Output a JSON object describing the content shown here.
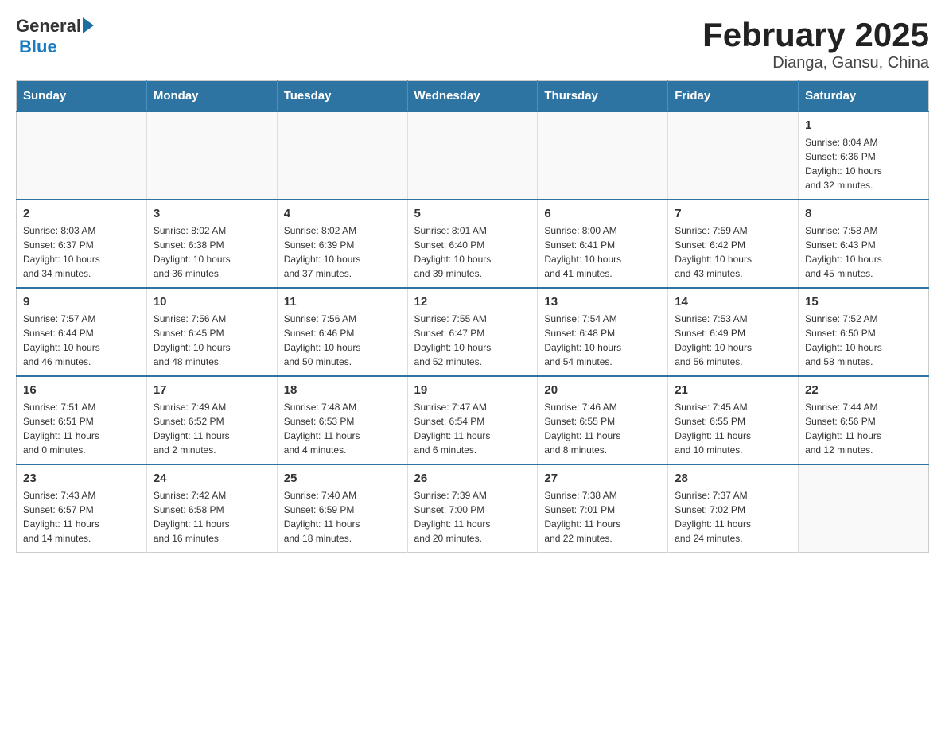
{
  "logo": {
    "general": "General",
    "blue": "Blue"
  },
  "title": "February 2025",
  "subtitle": "Dianga, Gansu, China",
  "weekdays": [
    "Sunday",
    "Monday",
    "Tuesday",
    "Wednesday",
    "Thursday",
    "Friday",
    "Saturday"
  ],
  "weeks": [
    [
      {
        "day": "",
        "info": ""
      },
      {
        "day": "",
        "info": ""
      },
      {
        "day": "",
        "info": ""
      },
      {
        "day": "",
        "info": ""
      },
      {
        "day": "",
        "info": ""
      },
      {
        "day": "",
        "info": ""
      },
      {
        "day": "1",
        "info": "Sunrise: 8:04 AM\nSunset: 6:36 PM\nDaylight: 10 hours\nand 32 minutes."
      }
    ],
    [
      {
        "day": "2",
        "info": "Sunrise: 8:03 AM\nSunset: 6:37 PM\nDaylight: 10 hours\nand 34 minutes."
      },
      {
        "day": "3",
        "info": "Sunrise: 8:02 AM\nSunset: 6:38 PM\nDaylight: 10 hours\nand 36 minutes."
      },
      {
        "day": "4",
        "info": "Sunrise: 8:02 AM\nSunset: 6:39 PM\nDaylight: 10 hours\nand 37 minutes."
      },
      {
        "day": "5",
        "info": "Sunrise: 8:01 AM\nSunset: 6:40 PM\nDaylight: 10 hours\nand 39 minutes."
      },
      {
        "day": "6",
        "info": "Sunrise: 8:00 AM\nSunset: 6:41 PM\nDaylight: 10 hours\nand 41 minutes."
      },
      {
        "day": "7",
        "info": "Sunrise: 7:59 AM\nSunset: 6:42 PM\nDaylight: 10 hours\nand 43 minutes."
      },
      {
        "day": "8",
        "info": "Sunrise: 7:58 AM\nSunset: 6:43 PM\nDaylight: 10 hours\nand 45 minutes."
      }
    ],
    [
      {
        "day": "9",
        "info": "Sunrise: 7:57 AM\nSunset: 6:44 PM\nDaylight: 10 hours\nand 46 minutes."
      },
      {
        "day": "10",
        "info": "Sunrise: 7:56 AM\nSunset: 6:45 PM\nDaylight: 10 hours\nand 48 minutes."
      },
      {
        "day": "11",
        "info": "Sunrise: 7:56 AM\nSunset: 6:46 PM\nDaylight: 10 hours\nand 50 minutes."
      },
      {
        "day": "12",
        "info": "Sunrise: 7:55 AM\nSunset: 6:47 PM\nDaylight: 10 hours\nand 52 minutes."
      },
      {
        "day": "13",
        "info": "Sunrise: 7:54 AM\nSunset: 6:48 PM\nDaylight: 10 hours\nand 54 minutes."
      },
      {
        "day": "14",
        "info": "Sunrise: 7:53 AM\nSunset: 6:49 PM\nDaylight: 10 hours\nand 56 minutes."
      },
      {
        "day": "15",
        "info": "Sunrise: 7:52 AM\nSunset: 6:50 PM\nDaylight: 10 hours\nand 58 minutes."
      }
    ],
    [
      {
        "day": "16",
        "info": "Sunrise: 7:51 AM\nSunset: 6:51 PM\nDaylight: 11 hours\nand 0 minutes."
      },
      {
        "day": "17",
        "info": "Sunrise: 7:49 AM\nSunset: 6:52 PM\nDaylight: 11 hours\nand 2 minutes."
      },
      {
        "day": "18",
        "info": "Sunrise: 7:48 AM\nSunset: 6:53 PM\nDaylight: 11 hours\nand 4 minutes."
      },
      {
        "day": "19",
        "info": "Sunrise: 7:47 AM\nSunset: 6:54 PM\nDaylight: 11 hours\nand 6 minutes."
      },
      {
        "day": "20",
        "info": "Sunrise: 7:46 AM\nSunset: 6:55 PM\nDaylight: 11 hours\nand 8 minutes."
      },
      {
        "day": "21",
        "info": "Sunrise: 7:45 AM\nSunset: 6:55 PM\nDaylight: 11 hours\nand 10 minutes."
      },
      {
        "day": "22",
        "info": "Sunrise: 7:44 AM\nSunset: 6:56 PM\nDaylight: 11 hours\nand 12 minutes."
      }
    ],
    [
      {
        "day": "23",
        "info": "Sunrise: 7:43 AM\nSunset: 6:57 PM\nDaylight: 11 hours\nand 14 minutes."
      },
      {
        "day": "24",
        "info": "Sunrise: 7:42 AM\nSunset: 6:58 PM\nDaylight: 11 hours\nand 16 minutes."
      },
      {
        "day": "25",
        "info": "Sunrise: 7:40 AM\nSunset: 6:59 PM\nDaylight: 11 hours\nand 18 minutes."
      },
      {
        "day": "26",
        "info": "Sunrise: 7:39 AM\nSunset: 7:00 PM\nDaylight: 11 hours\nand 20 minutes."
      },
      {
        "day": "27",
        "info": "Sunrise: 7:38 AM\nSunset: 7:01 PM\nDaylight: 11 hours\nand 22 minutes."
      },
      {
        "day": "28",
        "info": "Sunrise: 7:37 AM\nSunset: 7:02 PM\nDaylight: 11 hours\nand 24 minutes."
      },
      {
        "day": "",
        "info": ""
      }
    ]
  ]
}
